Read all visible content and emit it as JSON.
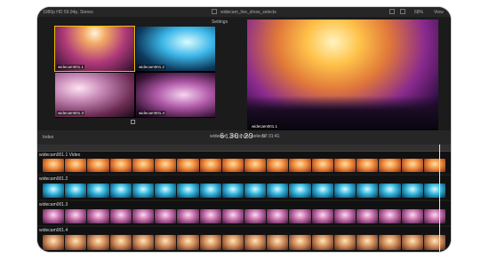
{
  "topbar": {
    "format": "1080p HD 59.94p, Stereo",
    "clip": "widecam_live_show_selects",
    "zoom": "68%",
    "view": "View"
  },
  "multicam": {
    "settings": "Settings",
    "angles": [
      "widecam001.1",
      "widecam001.2",
      "widecam001.3",
      "widecam001.4"
    ]
  },
  "viewer": {
    "label": "widecam001.1"
  },
  "timeline": {
    "index": "Index",
    "project": "widecam_live_show_selects",
    "duration": "07:31:41",
    "timecode": "6:30:29",
    "tracks": [
      "widecam001.1 Video",
      "widecam001.2",
      "widecam001.3",
      "widecam001.4"
    ]
  }
}
